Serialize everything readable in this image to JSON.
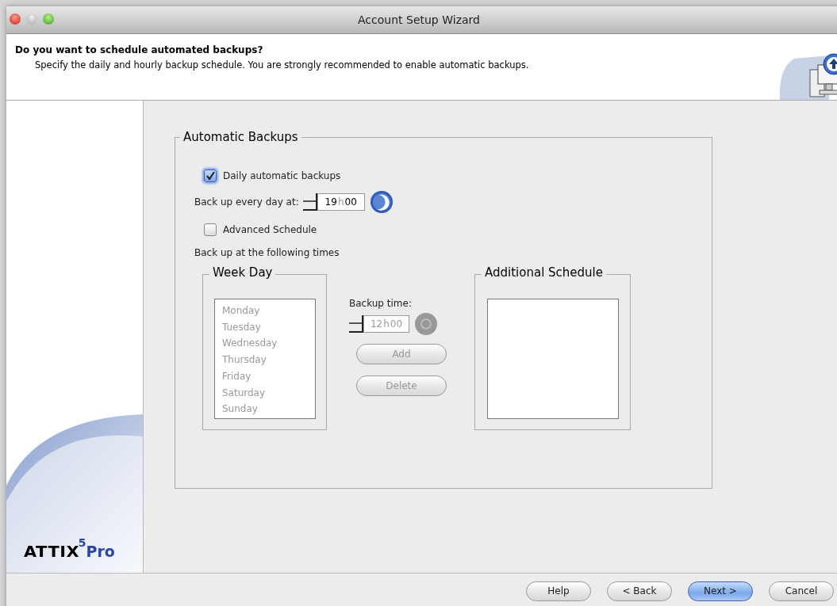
{
  "window": {
    "title": "Account Setup Wizard"
  },
  "header": {
    "title": "Do you want to schedule automated backups?",
    "subtitle": "Specify the daily and hourly backup schedule. You are strongly recommended to enable automatic backups."
  },
  "logo": {
    "name": "ATTIX",
    "superscript": "5",
    "suffix": "Pro"
  },
  "automatic_backups": {
    "title": "Automatic Backups",
    "daily": {
      "label": "Daily automatic backups",
      "checked": true
    },
    "daily_time": {
      "label": "Back up every day at:",
      "hours": "19",
      "separator": "h",
      "minutes": "00"
    },
    "advanced": {
      "label": "Advanced Schedule",
      "checked": false
    },
    "following_label": "Back up at the following times",
    "week_day": {
      "title": "Week Day",
      "disabled": true,
      "items": [
        "Monday",
        "Tuesday",
        "Wednesday",
        "Thursday",
        "Friday",
        "Saturday",
        "Sunday"
      ]
    },
    "backup_time": {
      "label": "Backup time:",
      "hours": "12",
      "separator": "h",
      "minutes": "00",
      "disabled": true
    },
    "buttons": [
      {
        "label": "Add",
        "disabled": true
      },
      {
        "label": "Delete",
        "disabled": true
      }
    ],
    "additional_schedule": {
      "title": "Additional Schedule"
    }
  },
  "footer_buttons": [
    {
      "label": "Help",
      "default": false
    },
    {
      "label": "< Back",
      "default": false
    },
    {
      "label": "Next >",
      "default": true
    },
    {
      "label": "Cancel",
      "default": false
    }
  ]
}
